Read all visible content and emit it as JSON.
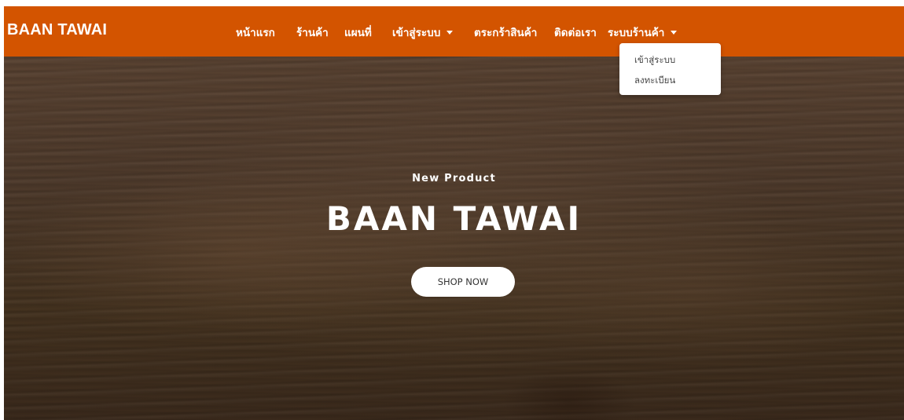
{
  "brand": "BAAN TAWAI",
  "nav": {
    "items": [
      {
        "label": "หน้าแรก"
      },
      {
        "label": "ร้านค้า"
      },
      {
        "label": "แผนที่"
      },
      {
        "label": "เข้าสู่ระบบ",
        "has_dropdown": true
      },
      {
        "label": "ตระกร้าสินค้า"
      },
      {
        "label": "ติดต่อเรา"
      },
      {
        "label": "ระบบร้านค้า",
        "has_dropdown": true,
        "expanded": true
      }
    ]
  },
  "dropdown": {
    "items": [
      {
        "label": "เข้าสู่ระบบ"
      },
      {
        "label": "ลงทะเบียน"
      }
    ]
  },
  "hero": {
    "subtitle": "New Product",
    "title": "BAAN TAWAI",
    "button_label": "SHOP NOW"
  },
  "colors": {
    "navbar": "#d35400",
    "nav_text": "#ffffff",
    "dropdown_bg": "#ffffff",
    "button_bg": "#ffffff"
  }
}
